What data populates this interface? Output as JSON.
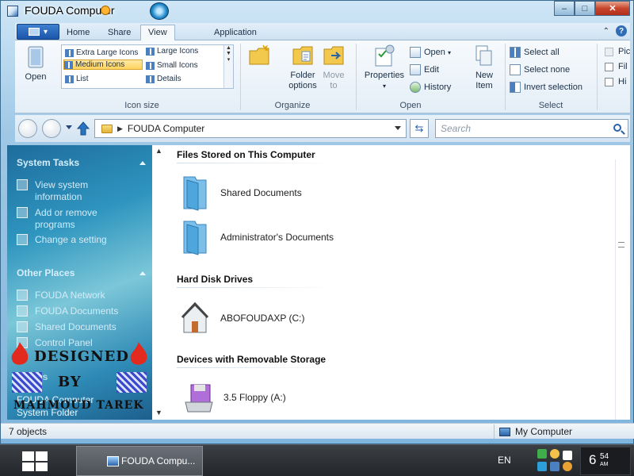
{
  "window": {
    "title": "FOUDA Computer",
    "caption_buttons": {
      "minimize": "‒",
      "maximize": "□",
      "close": "✕"
    }
  },
  "ribbon": {
    "tabs": [
      "Home",
      "Share",
      "View",
      "Application"
    ],
    "active_tab": "View",
    "layout_gallery": {
      "items": [
        "Extra Large Icons",
        "Large Icons",
        "Medium Icons",
        "Small Icons",
        "List",
        "Details"
      ],
      "selected": "Medium Icons"
    },
    "open_button": "Open",
    "group_labels": {
      "icon_size": "Icon size",
      "organize": "Organize",
      "open": "Open",
      "select": "Select"
    },
    "folder_options": "Folder options",
    "move_to": "Move to",
    "properties": "Properties",
    "open_menu": "Open",
    "edit": "Edit",
    "history": "History",
    "new_item": "New Item",
    "select_all": "Select all",
    "select_none": "Select none",
    "invert_selection": "Invert selection",
    "show_hide": [
      "Pic",
      "Fil",
      "Hi"
    ]
  },
  "address_bar": {
    "path": "FOUDA Computer",
    "search_placeholder": "Search"
  },
  "task_pane": {
    "system_tasks": {
      "heading": "System Tasks",
      "items": [
        "View system information",
        "Add or remove programs",
        "Change a setting"
      ]
    },
    "other_places": {
      "heading": "Other Places",
      "items": [
        "FOUDA Network",
        "FOUDA Documents",
        "Shared Documents",
        "Control Panel"
      ]
    },
    "details": {
      "heading": "Details",
      "name": "FOUDA Computer",
      "type": "System Folder"
    },
    "watermark": [
      "DESIGNED",
      "BY",
      "MAHMOUD TAREK"
    ]
  },
  "content": {
    "sections": [
      {
        "heading": "Files Stored on This Computer",
        "items": [
          "Shared Documents",
          "Administrator's Documents"
        ]
      },
      {
        "heading": "Hard Disk Drives",
        "items": [
          "ABOFOUDAXP (C:)"
        ]
      },
      {
        "heading": "Devices with Removable Storage",
        "items": [
          "3.5 Floppy (A:)"
        ]
      }
    ]
  },
  "status_bar": {
    "count": "7 objects",
    "location": "My Computer"
  },
  "taskbar": {
    "task_button": "FOUDA Compu...",
    "language": "EN",
    "clock_hour": "6",
    "clock_minute": "54",
    "clock_ampm": "AM"
  },
  "colors": {
    "ribbon_bg": "#eef4fa",
    "task_pane_bg": "#2e95bf",
    "close_button": "#c7452b",
    "selection": "#ffd35c"
  }
}
